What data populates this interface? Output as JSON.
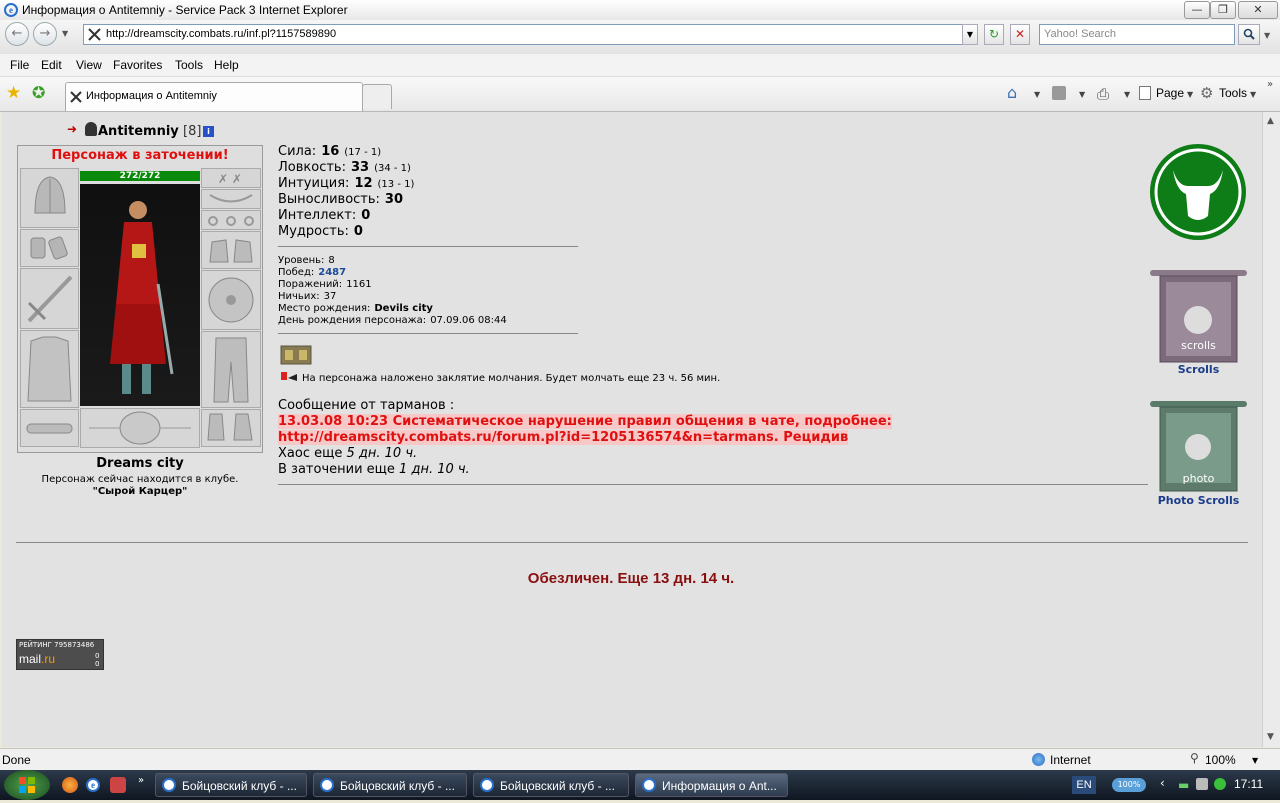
{
  "window": {
    "title": "Информация о Antitemniy - Service Pack 3 Internet Explorer",
    "url": "http://dreamscity.combats.ru/inf.pl?1157589890",
    "search_placeholder": "Yahoo! Search"
  },
  "menu": [
    "File",
    "Edit",
    "View",
    "Favorites",
    "Tools",
    "Help"
  ],
  "tab": {
    "label": "Информация о Antitemniy"
  },
  "toolbar": {
    "page_label": "Page",
    "tools_label": "Tools"
  },
  "character": {
    "name": "Antitemniy",
    "level_tag": "[8]",
    "jail_banner": "Персонаж в заточении!",
    "hp": "272/272",
    "city": "Dreams city",
    "location_text": "Персонаж сейчас находится в клубе.",
    "location_place": "\"Сырой Карцер\""
  },
  "stats": [
    {
      "label": "Сила:",
      "value": "16",
      "extra": "(17 - 1)"
    },
    {
      "label": "Ловкость:",
      "value": "33",
      "extra": "(34 - 1)"
    },
    {
      "label": "Интуиция:",
      "value": "12",
      "extra": "(13 - 1)"
    },
    {
      "label": "Выносливость:",
      "value": "30",
      "extra": ""
    },
    {
      "label": "Интеллект:",
      "value": "0",
      "extra": ""
    },
    {
      "label": "Мудрость:",
      "value": "0",
      "extra": ""
    }
  ],
  "details": [
    {
      "label": "Уровень:",
      "value": "8"
    },
    {
      "label": "Побед:",
      "value": "2487"
    },
    {
      "label": "Поражений:",
      "value": "1161"
    },
    {
      "label": "Ничьих:",
      "value": "37"
    },
    {
      "label": "Место рождения:",
      "value": "Devils city"
    },
    {
      "label": "День рождения персонажа:",
      "value": "07.09.06 08:44"
    }
  ],
  "silence_text": "На персонажа наложено заклятие молчания. Будет молчать еще 23 ч. 56 мин.",
  "tarmans": {
    "header": "Сообщение от тарманов :",
    "line1": "13.03.08 10:23 Систематическое нарушение правил общения в чате, подробнее:",
    "line2": "http://dreamscity.combats.ru/forum.pl?id=1205136574&n=tarmans. Рецидив",
    "chaos_label": "Хаос еще",
    "chaos_time": "5 дн. 10 ч.",
    "jail_label": "В заточении еще",
    "jail_time": "1 дн. 10 ч."
  },
  "faceless": "Обезличен. Еще 13 дн. 14 ч.",
  "side": {
    "scrolls_label": "Scrolls",
    "scrolls_banner": "scrolls",
    "photo_label": "Photo Scrolls",
    "photo_banner": "photo"
  },
  "rating": {
    "label": "РЕЙТИНГ 795873486",
    "brand": "mail",
    "brand_suffix": ".ru",
    "c1": "0",
    "c2": "0"
  },
  "status": {
    "left": "Done",
    "zone": "Internet",
    "zoom": "100%"
  },
  "taskbar": {
    "items": [
      "Бойцовский клуб - ...",
      "Бойцовский клуб - ...",
      "Бойцовский клуб - ...",
      "Информация о Ant..."
    ],
    "lang": "EN",
    "battery": "100%",
    "clock": "17:11"
  }
}
